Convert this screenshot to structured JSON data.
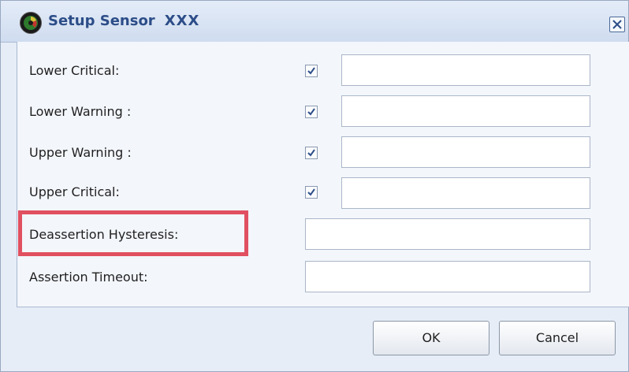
{
  "dialog": {
    "title": "Setup Sensor",
    "title_suffix": "XXX",
    "close_icon": "close-icon"
  },
  "rows": [
    {
      "label": "Lower Critical:",
      "checked": true,
      "value": ""
    },
    {
      "label": "Lower Warning :",
      "checked": true,
      "value": ""
    },
    {
      "label": "Upper Warning :",
      "checked": true,
      "value": ""
    },
    {
      "label": "Upper Critical:",
      "checked": true,
      "value": ""
    },
    {
      "label": "Deassertion Hysteresis:",
      "value": "",
      "highlighted": true
    },
    {
      "label": "Assertion Timeout:",
      "value": ""
    }
  ],
  "buttons": {
    "ok": "OK",
    "cancel": "Cancel"
  },
  "colors": {
    "title_text": "#2c4d88",
    "highlight": "#e05060",
    "dialog_bg": "#e6edf7",
    "content_bg": "#f3f6fb"
  }
}
